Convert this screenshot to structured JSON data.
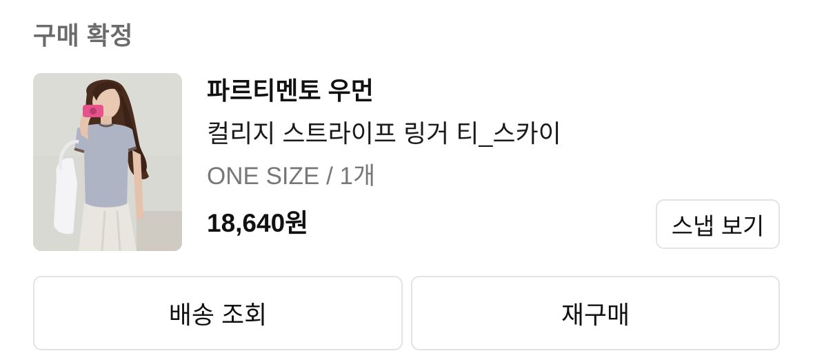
{
  "order": {
    "status_title": "구매 확정"
  },
  "product": {
    "image_alt": "상품 이미지",
    "brand": "파르티멘토 우먼",
    "name": "컬리지 스트라이프 링거 티_스카이",
    "option": "ONE SIZE / 1개",
    "price": "18,640원",
    "snap_label": "스냅 보기"
  },
  "actions": {
    "track_label": "배송 조회",
    "reorder_label": "재구매"
  }
}
